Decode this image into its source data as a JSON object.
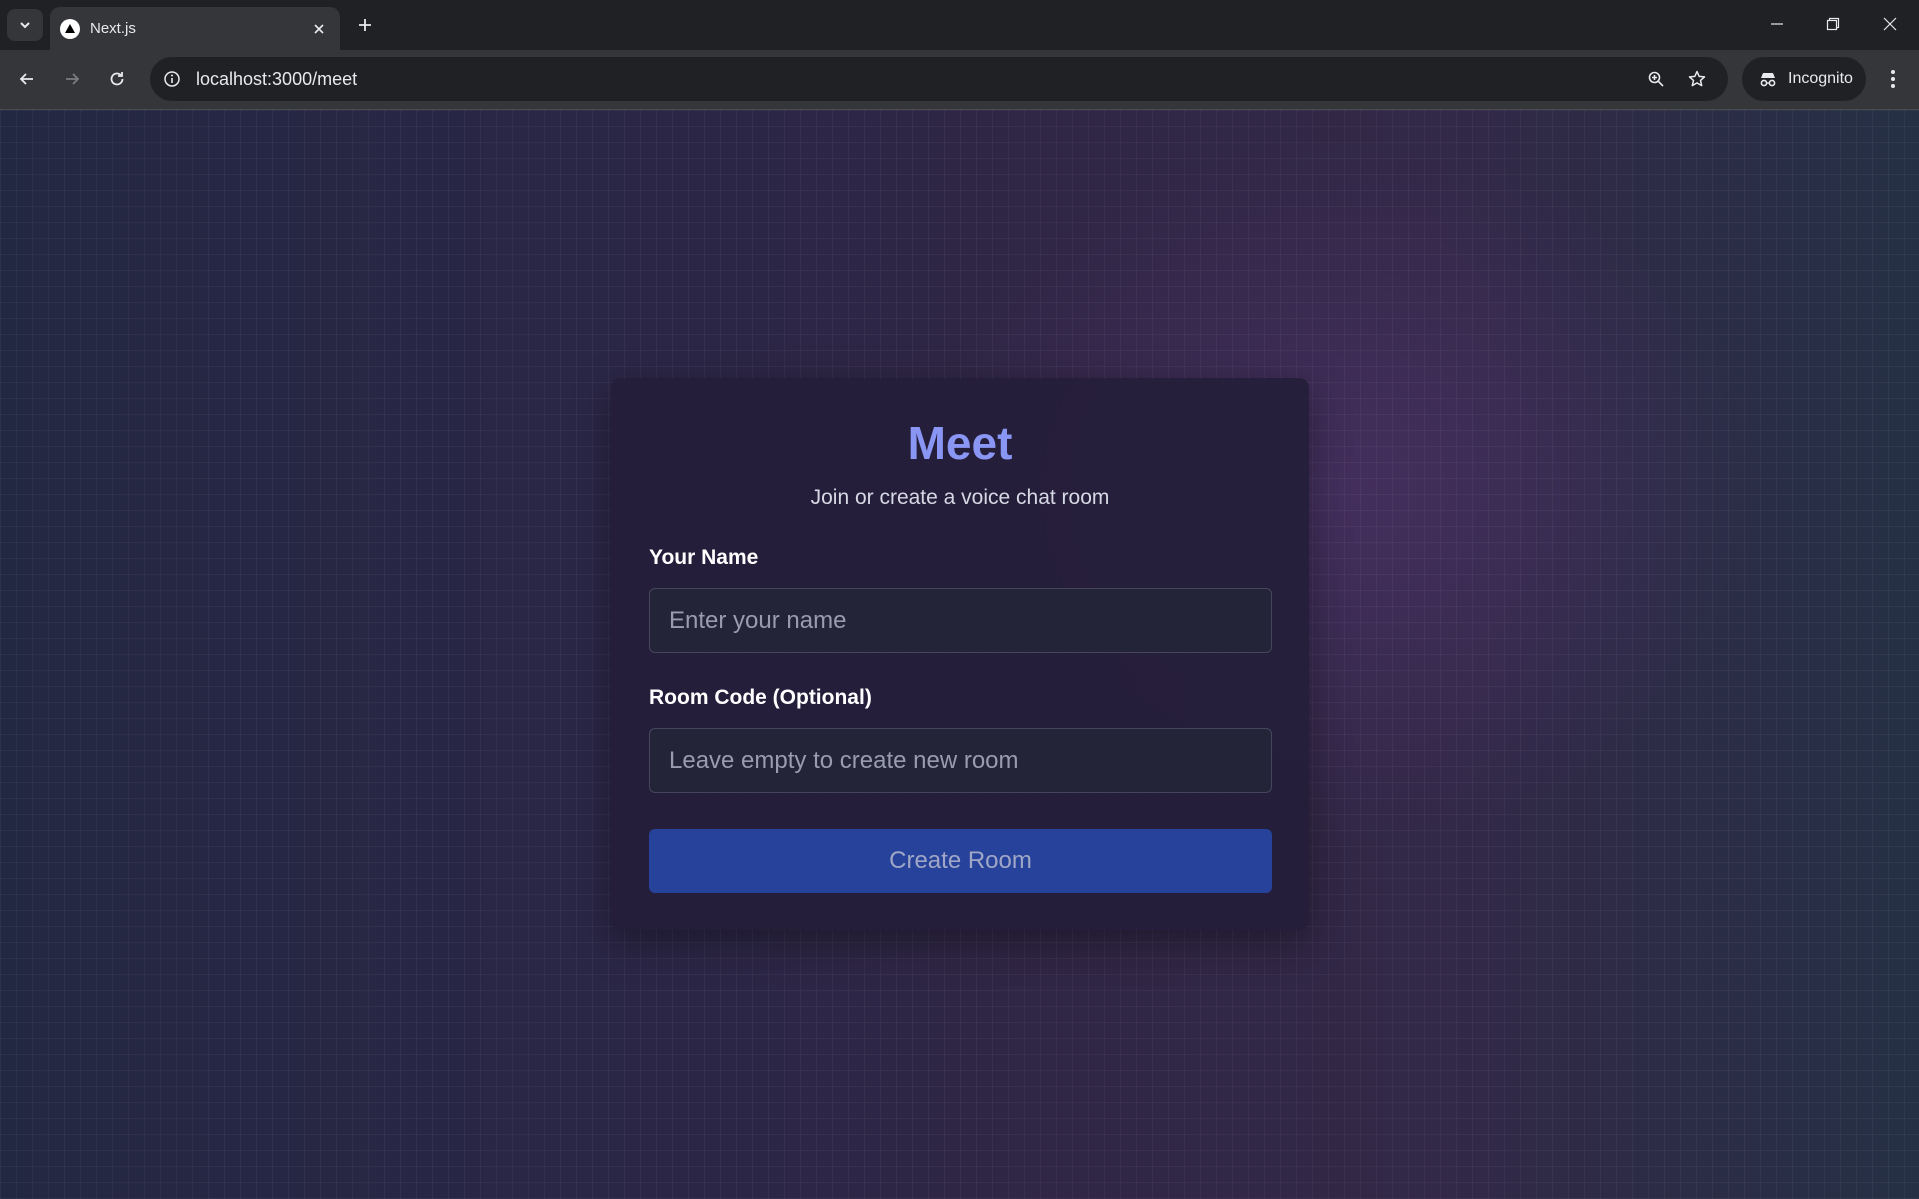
{
  "browser": {
    "tab_title": "Next.js",
    "url": "localhost:3000/meet",
    "incognito_label": "Incognito"
  },
  "card": {
    "title": "Meet",
    "subtitle": "Join or create a voice chat room",
    "name_label": "Your Name",
    "name_placeholder": "Enter your name",
    "room_label": "Room Code (Optional)",
    "room_placeholder": "Leave empty to create new room",
    "create_button": "Create Room"
  },
  "colors": {
    "title_accent": "#8a96f3",
    "button_bg": "#27429a",
    "card_bg": "#251e3a"
  }
}
